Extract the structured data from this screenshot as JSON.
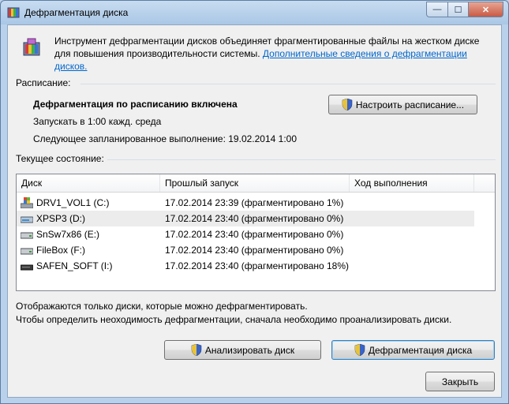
{
  "window": {
    "title": "Дефрагментация диска",
    "minimize_glyph": "—",
    "maximize_glyph": "☐",
    "close_glyph": "✕"
  },
  "intro": {
    "text": "Инструмент дефрагментации дисков объединяет фрагментированные файлы на жестком диске для повышения производительности системы. ",
    "link": "Дополнительные сведения о дефрагментации дисков."
  },
  "schedule": {
    "group_label": "Расписание:",
    "status": "Дефрагментация по расписанию включена",
    "run_text": "Запускать в 1:00 кажд. среда",
    "next_text": "Следующее запланированное выполнение: 19.02.2014 1:00",
    "configure_button": "Настроить расписание..."
  },
  "current": {
    "group_label": "Текущее состояние:",
    "columns": [
      "Диск",
      "Прошлый запуск",
      "Ход выполнения"
    ],
    "rows": [
      {
        "disk": "DRV1_VOL1 (C:)",
        "last_run": "17.02.2014 23:39 (фрагментировано 1%)",
        "progress": "",
        "icon": "windows-drive-icon"
      },
      {
        "disk": "XPSP3 (D:)",
        "last_run": "17.02.2014 23:40 (фрагментировано 0%)",
        "progress": "",
        "icon": "hard-drive-icon"
      },
      {
        "disk": "SnSw7x86 (E:)",
        "last_run": "17.02.2014 23:40 (фрагментировано 0%)",
        "progress": "",
        "icon": "hard-drive-icon"
      },
      {
        "disk": "FileBox (F:)",
        "last_run": "17.02.2014 23:40 (фрагментировано 0%)",
        "progress": "",
        "icon": "hard-drive-icon"
      },
      {
        "disk": "SAFEN_SOFT (I:)",
        "last_run": "17.02.2014 23:40 (фрагментировано 18%)",
        "progress": "",
        "icon": "usb-drive-icon"
      }
    ]
  },
  "notes": {
    "line1": "Отображаются только диски, которые можно дефрагментировать.",
    "line2": "Чтобы определить неоходимость  дефрагментации, сначала необходимо проанализировать диски."
  },
  "actions": {
    "analyze_button": "Анализировать диск",
    "defrag_button": "Дефрагментация диска",
    "close_button": "Закрыть"
  }
}
